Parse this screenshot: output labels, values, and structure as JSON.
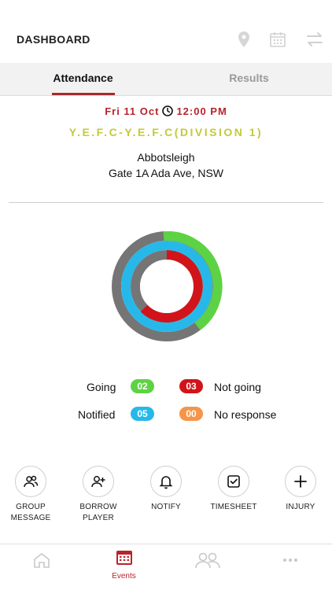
{
  "header": {
    "title": "DASHBOARD",
    "icons": [
      "location-pin-icon",
      "calendar-icon",
      "swap-arrows-icon"
    ]
  },
  "tabs": [
    {
      "label": "Attendance",
      "active": true
    },
    {
      "label": "Results",
      "active": false
    }
  ],
  "event": {
    "date": "Fri 11 Oct",
    "time": "12:00 PM",
    "match": "Y.E.F.C-Y.E.F.C(DIVISION 1)",
    "venue_name": "Abbotsleigh",
    "venue_address": "Gate 1A Ada Ave, NSW"
  },
  "attendance": {
    "going": {
      "label": "Going",
      "count": "02",
      "color": "#5ed245"
    },
    "not_going": {
      "label": "Not going",
      "count": "03",
      "color": "#d0141a"
    },
    "notified": {
      "label": "Notified",
      "count": "05",
      "color": "#27b8ea"
    },
    "no_response": {
      "label": "No response",
      "count": "00",
      "color": "#f5954a"
    }
  },
  "actions": [
    {
      "line1": "GROUP",
      "line2": "MESSAGE",
      "icon": "group-message-icon"
    },
    {
      "line1": "BORROW",
      "line2": "PLAYER",
      "icon": "add-player-icon"
    },
    {
      "line1": "NOTIFY",
      "line2": "",
      "icon": "bell-icon"
    },
    {
      "line1": "TIMESHEET",
      "line2": "",
      "icon": "checkbox-icon"
    },
    {
      "line1": "INJURY",
      "line2": "",
      "icon": "plus-icon"
    }
  ],
  "bottom_nav": [
    {
      "label": "",
      "icon": "home-icon",
      "active": false
    },
    {
      "label": "Events",
      "icon": "events-calendar-icon",
      "active": true
    },
    {
      "label": "",
      "icon": "team-icon",
      "active": false
    },
    {
      "label": "",
      "icon": "more-icon",
      "active": false
    }
  ],
  "colors": {
    "accent": "#b8242c",
    "match_text": "#c3c93a",
    "ring_grey": "#757575"
  }
}
